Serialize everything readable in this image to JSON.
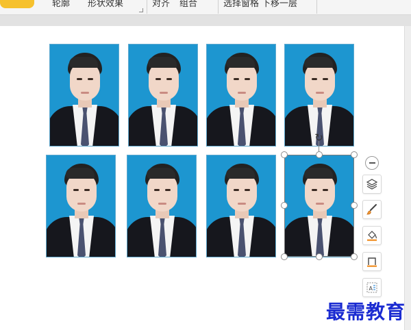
{
  "ribbon": {
    "items": [
      {
        "label": "轮廓"
      },
      {
        "label": "形状效果"
      },
      {
        "label": "对齐"
      },
      {
        "label": "组合"
      },
      {
        "label": "选择窗格"
      },
      {
        "label": "下移一层"
      }
    ],
    "accent_color": "#f6c12d"
  },
  "photos": [
    {
      "name": "id-photo-1"
    },
    {
      "name": "id-photo-2"
    },
    {
      "name": "id-photo-3"
    },
    {
      "name": "id-photo-4"
    },
    {
      "name": "id-photo-5"
    },
    {
      "name": "id-photo-6"
    },
    {
      "name": "id-photo-7"
    },
    {
      "name": "id-photo-8"
    }
  ],
  "photo_background_color": "#1d96d0",
  "side_tools": [
    {
      "icon": "minus-circle-icon"
    },
    {
      "icon": "layers-icon"
    },
    {
      "icon": "brush-icon"
    },
    {
      "icon": "fill-bucket-icon"
    },
    {
      "icon": "border-outline-icon"
    },
    {
      "icon": "text-wrap-icon"
    }
  ],
  "watermark": {
    "text": "最需教育",
    "color": "#1a2bd1"
  }
}
